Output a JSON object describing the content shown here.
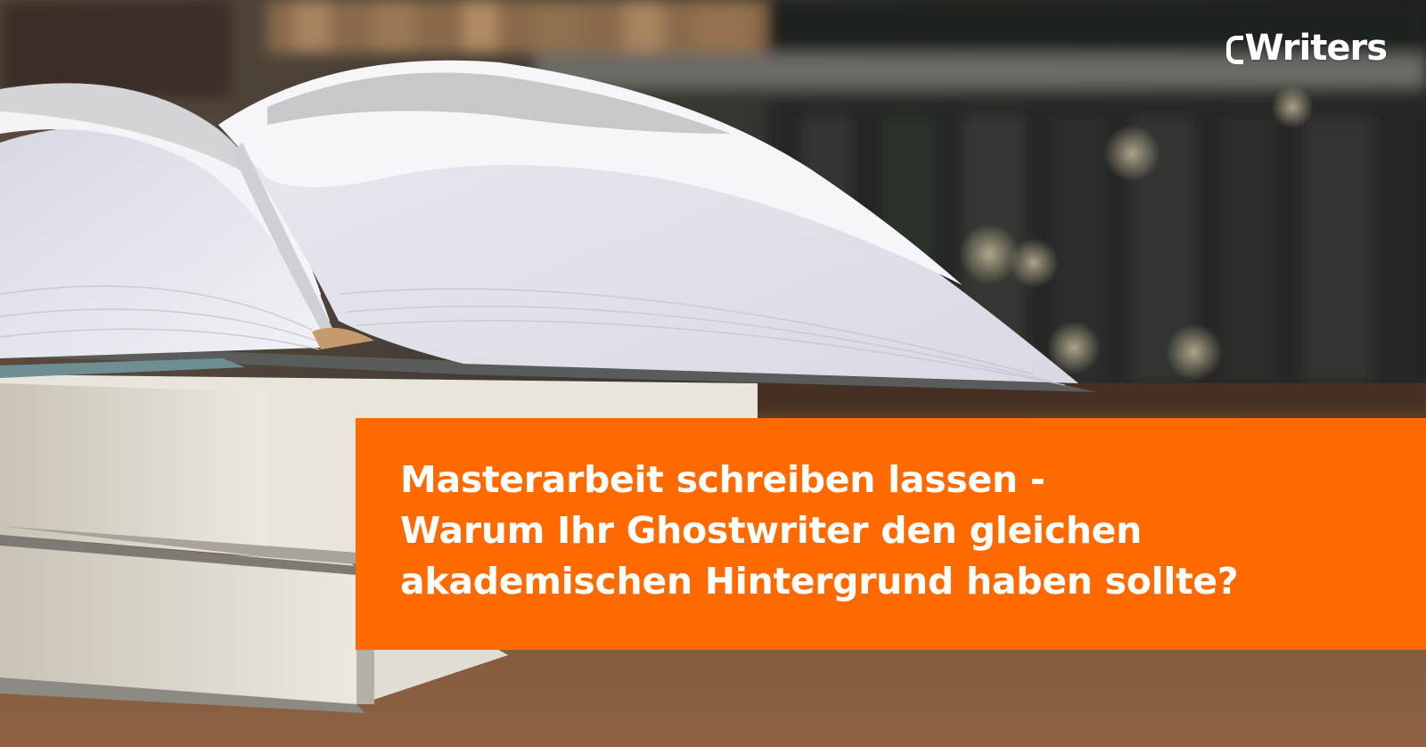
{
  "logo": {
    "text": "Writers"
  },
  "banner": {
    "title_lines": [
      "Masterarbeit schreiben lassen -",
      "Warum Ihr Ghostwriter den gleichen",
      "akademischen Hintergrund haben sollte?"
    ]
  },
  "colors": {
    "banner": "#ff6a00",
    "title_text": "#ffffff",
    "desk": "#6e4a33",
    "shelf_background": "#2b2e2b"
  },
  "icons": [
    "logo-mark-icon"
  ]
}
